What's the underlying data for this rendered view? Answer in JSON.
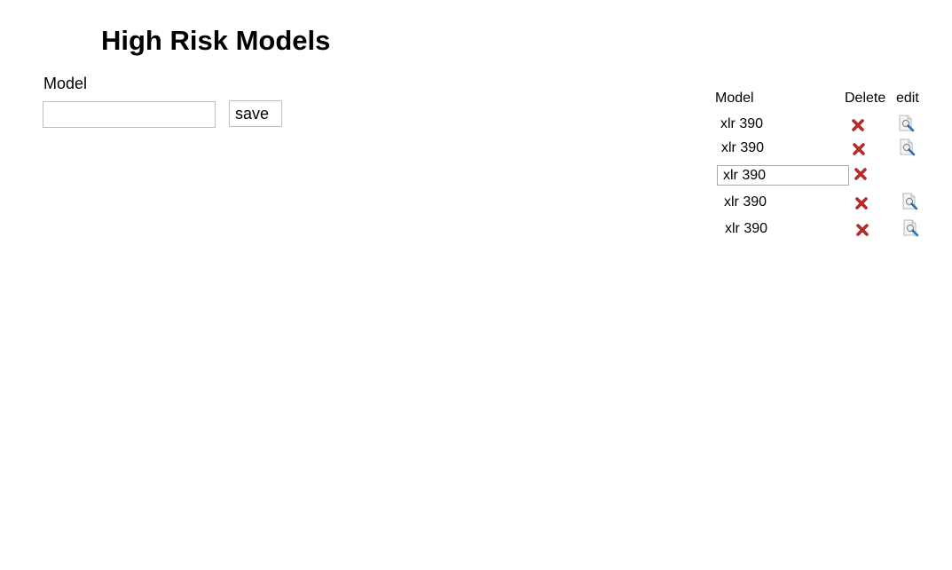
{
  "page": {
    "title": "High Risk Models"
  },
  "form": {
    "model_label": "Model",
    "model_value": "",
    "save_label": "save"
  },
  "table": {
    "headers": {
      "model": "Model",
      "delete": "Delete",
      "edit": "edit"
    },
    "rows": [
      {
        "model": "xlr 390",
        "editing": false
      },
      {
        "model": "xlr 390",
        "editing": false
      },
      {
        "model": "xlr 390",
        "editing": true
      },
      {
        "model": "xlr 390",
        "editing": false
      },
      {
        "model": "xlr 390",
        "editing": false
      }
    ]
  },
  "icons": {
    "delete": "close-x-icon",
    "edit": "magnifier-document-icon"
  },
  "colors": {
    "delete_icon": "#b52a2a",
    "edit_icon_glass": "#2a6fb5"
  }
}
